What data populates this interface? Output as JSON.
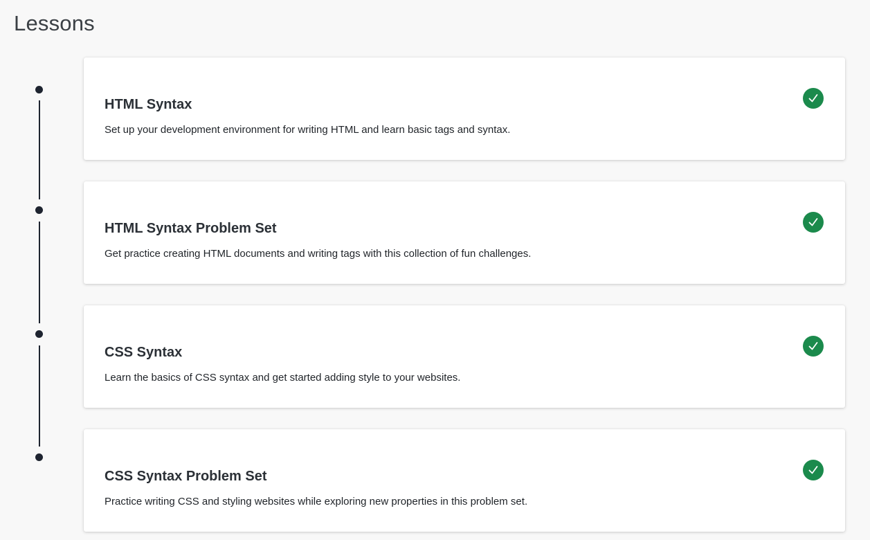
{
  "page": {
    "title": "Lessons"
  },
  "lessons": [
    {
      "title": "HTML Syntax",
      "description": "Set up your development environment for writing HTML and learn basic tags and syntax.",
      "status": "completed"
    },
    {
      "title": "HTML Syntax Problem Set",
      "description": "Get practice creating HTML documents and writing tags with this collection of fun challenges.",
      "status": "completed"
    },
    {
      "title": "CSS Syntax",
      "description": "Learn the basics of CSS syntax and get started adding style to your websites.",
      "status": "completed"
    },
    {
      "title": "CSS Syntax Problem Set",
      "description": "Practice writing CSS and styling websites while exploring new properties in this problem set.",
      "status": "completed"
    }
  ],
  "icons": {
    "complete": "check-circle-icon",
    "timeline_node": "timeline-dot"
  },
  "colors": {
    "complete_green": "#1b8a4c",
    "timeline": "#1e2430",
    "background": "#f8f8f8"
  }
}
